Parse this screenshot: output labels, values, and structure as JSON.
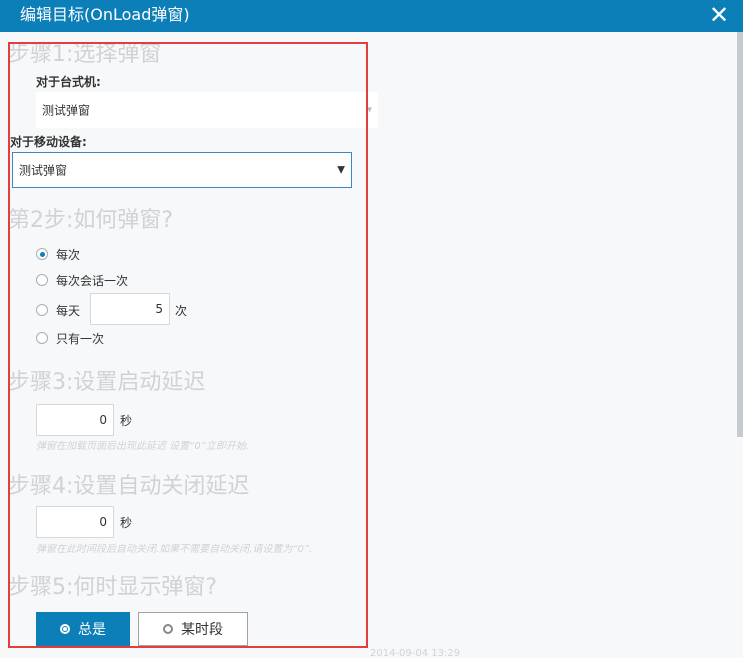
{
  "dialog": {
    "title": "编辑目标(OnLoad弹窗)",
    "close_icon": "close-icon"
  },
  "step1": {
    "title": "步骤1:选择弹窗",
    "desktop_label": "对于台式机:",
    "desktop_value": "测试弹窗",
    "mobile_label": "对于移动设备:",
    "mobile_value": "测试弹窗"
  },
  "step2": {
    "title": "第2步:如何弹窗?",
    "options": [
      "每次",
      "每次会话一次",
      "每天",
      "只有一次"
    ],
    "selected": "每次",
    "daily_value": "5",
    "daily_unit": "次"
  },
  "step3": {
    "title": "步骤3:设置启动延迟",
    "value": "0",
    "unit": "秒",
    "hint": "弹窗在加载页面后出现此延迟 设置“0”立即开始."
  },
  "step4": {
    "title": "步骤4:设置自动关闭延迟",
    "value": "0",
    "unit": "秒",
    "hint": "弹窗在此时间段后自动关闭.如果不需要自动关闭,请设置为“0”."
  },
  "step5": {
    "title": "步骤5:何时显示弹窗?",
    "always_label": "总是",
    "period_label": "某时段",
    "footer": "2014-09-04 13:29"
  },
  "colors": {
    "accent": "#0d7fb8",
    "highlight": "#e43d3d"
  }
}
